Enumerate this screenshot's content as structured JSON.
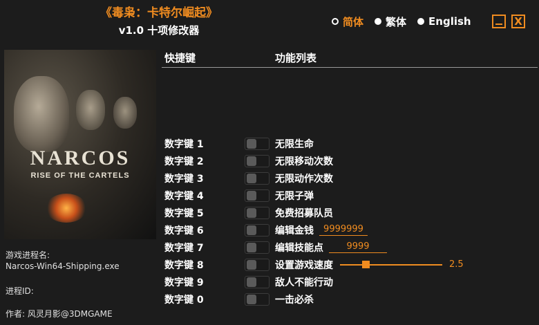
{
  "window": {
    "title": "《毒枭：卡特尔崛起》",
    "subtitle": "v1.0 十项修改器",
    "accent": "#f08c20"
  },
  "languages": [
    {
      "label": "简体",
      "selected": true
    },
    {
      "label": "繁体",
      "selected": false
    },
    {
      "label": "English",
      "selected": false
    }
  ],
  "window_controls": {
    "minimize_icon": "minimize-icon",
    "close_label": "X"
  },
  "cover": {
    "logo_title": "NARCOS",
    "logo_subtitle": "RISE OF THE CARTELS"
  },
  "process": {
    "name_label": "游戏进程名:",
    "name_value": "Narcos-Win64-Shipping.exe",
    "id_label": "进程ID:",
    "id_value": "",
    "author": "作者: 风灵月影@3DMGAME"
  },
  "table": {
    "col_hotkey": "快捷键",
    "col_features": "功能列表"
  },
  "cheats": [
    {
      "key": "数字键 1",
      "label": "无限生命"
    },
    {
      "key": "数字键 2",
      "label": "无限移动次数"
    },
    {
      "key": "数字键 3",
      "label": "无限动作次数"
    },
    {
      "key": "数字键 4",
      "label": "无限子弹"
    },
    {
      "key": "数字键 5",
      "label": "免费招募队员"
    },
    {
      "key": "数字键 6",
      "label": "编辑金钱",
      "value": "9999999"
    },
    {
      "key": "数字键 7",
      "label": "编辑技能点",
      "value": "9999"
    },
    {
      "key": "数字键 8",
      "label": "设置游戏速度",
      "slider_value": "2.5"
    },
    {
      "key": "数字键 9",
      "label": "敌人不能行动"
    },
    {
      "key": "数字键 0",
      "label": "一击必杀"
    }
  ]
}
